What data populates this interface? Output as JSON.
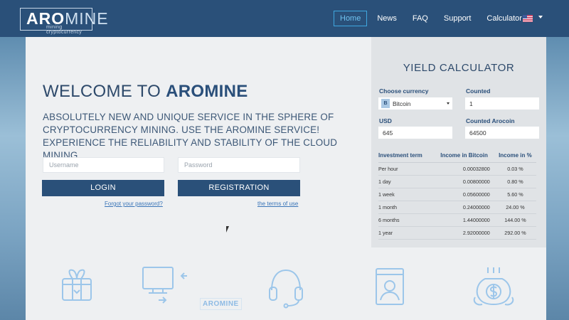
{
  "logo": {
    "brand_bold": "ARO",
    "brand_thin": "MINE",
    "tagline": "mining cryptocurrency"
  },
  "nav": {
    "items": [
      {
        "label": "Home",
        "active": true
      },
      {
        "label": "News",
        "active": false
      },
      {
        "label": "FAQ",
        "active": false
      },
      {
        "label": "Support",
        "active": false
      },
      {
        "label": "Calculator",
        "active": false
      }
    ],
    "language_icon": "us-flag-icon"
  },
  "hero": {
    "title_prefix": "WELCOME TO",
    "title_brand": "AROMINE",
    "intro": "ABSOLUTELY NEW AND UNIQUE SERVICE IN THE SPHERE OF CRYPTOCURRENCY MINING. USE THE AROMINE SERVICE! EXPERIENCE THE RELIABILITY AND STABILITY OF THE CLOUD MINING."
  },
  "login": {
    "username_placeholder": "Username",
    "password_placeholder": "Password",
    "login_label": "LOGIN",
    "registration_label": "REGISTRATION",
    "forgot_link": "Forgot your password?",
    "terms_link": "the terms of use"
  },
  "calculator": {
    "title": "YIELD CALCULATOR",
    "choose_currency_label": "Choose currency",
    "currency_value": "Bitcoin",
    "currency_icon_letter": "B",
    "counted_label": "Counted",
    "counted_value": "1",
    "usd_label": "USD",
    "usd_value": "645",
    "counted_arocoin_label": "Counted Arocoin",
    "counted_arocoin_value": "64500",
    "table": {
      "headers": [
        "Investment term",
        "Income in Bitcoin",
        "Income in %"
      ],
      "rows": [
        [
          "Per hour",
          "0.00032800",
          "0.03 %"
        ],
        [
          "1 day",
          "0.00800000",
          "0.80 %"
        ],
        [
          "1 week",
          "0.05600000",
          "5.60 %"
        ],
        [
          "1 month",
          "0.24000000",
          "24.00 %"
        ],
        [
          "6 months",
          "1.44000000",
          "144.00 %"
        ],
        [
          "1 year",
          "2.92000000",
          "292.00 %"
        ]
      ]
    }
  },
  "features": {
    "icons": [
      "gift-box-icon",
      "monitor-transfer-icon",
      "headset-icon",
      "user-profile-icon",
      "money-bag-icon"
    ],
    "transfer_word": "AROMINE"
  },
  "colors": {
    "navbar": "#2a5079",
    "accent": "#3fa7e0",
    "button": "#2a5079",
    "panel": "#eef0f2",
    "icon_light": "#8ebbe4"
  }
}
